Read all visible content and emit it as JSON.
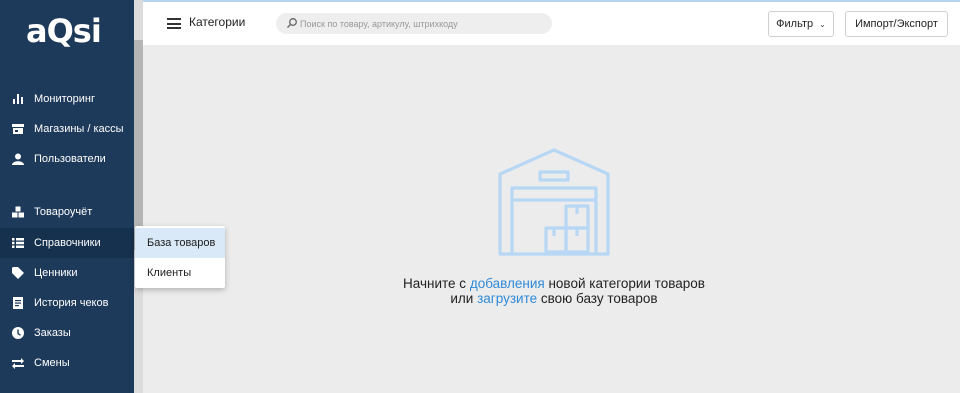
{
  "app": {
    "logo_text": "aQsi"
  },
  "sidebar": {
    "items": [
      {
        "label": "Мониторинг",
        "icon": "bar-chart-icon"
      },
      {
        "label": "Магазины / кассы",
        "icon": "store-icon"
      },
      {
        "label": "Пользователи",
        "icon": "user-icon"
      },
      {
        "label": "Товароучёт",
        "icon": "boxes-icon"
      },
      {
        "label": "Справочники",
        "icon": "list-icon",
        "active": true
      },
      {
        "label": "Ценники",
        "icon": "tag-icon"
      },
      {
        "label": "История чеков",
        "icon": "receipt-icon"
      },
      {
        "label": "Заказы",
        "icon": "clock-icon"
      },
      {
        "label": "Смены",
        "icon": "swap-icon"
      }
    ]
  },
  "submenu": {
    "items": [
      {
        "label": "База товаров",
        "hovered": true
      },
      {
        "label": "Клиенты"
      }
    ]
  },
  "header": {
    "title": "Категории",
    "search_placeholder": "Поиск по товару, артикулу, штрихкоду",
    "filter_label": "Фильтр",
    "import_label": "Импорт/Экспорт"
  },
  "empty_state": {
    "line1_prefix": "Начните с",
    "line1_link": "добавления",
    "line1_suffix": "новой категории товаров",
    "line2_prefix": "или",
    "line2_link": "загрузите",
    "line2_suffix": "свою базу товаров"
  },
  "colors": {
    "sidebar_bg": "#1e3a5a",
    "link": "#2f8ad8",
    "illustration": "#b7d7f5",
    "submenu_hover": "#d9e9f8"
  }
}
